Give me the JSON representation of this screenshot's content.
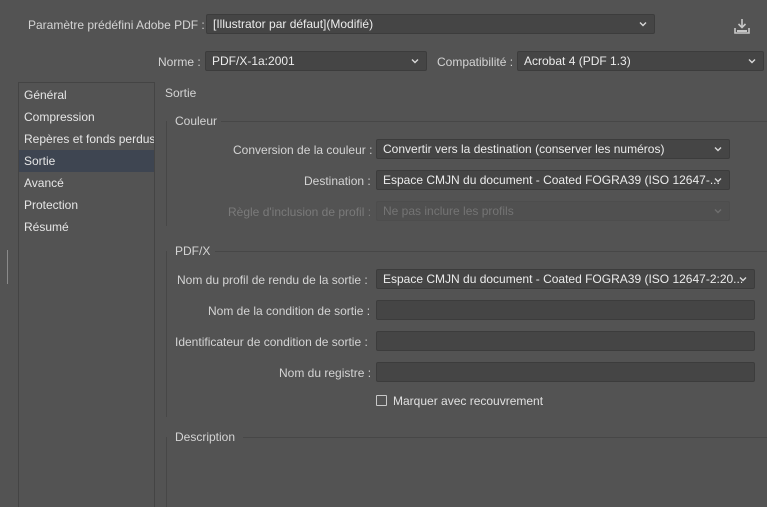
{
  "preset": {
    "label": "Paramètre prédéfini Adobe PDF :",
    "value": "[Illustrator par défaut](Modifié)"
  },
  "standard": {
    "label": "Norme :",
    "value": "PDF/X-1a:2001"
  },
  "compatibility": {
    "label": "Compatibilité :",
    "value": "Acrobat 4 (PDF 1.3)"
  },
  "sidebar": {
    "items": [
      {
        "label": "Général"
      },
      {
        "label": "Compression"
      },
      {
        "label": "Repères et fonds perdus"
      },
      {
        "label": "Sortie"
      },
      {
        "label": "Avancé"
      },
      {
        "label": "Protection"
      },
      {
        "label": "Résumé"
      }
    ],
    "selected": "Sortie"
  },
  "panel": {
    "title": "Sortie",
    "couleur": {
      "title": "Couleur",
      "conversion": {
        "label": "Conversion de la couleur :",
        "value": "Convertir vers la destination (conserver les numéros)"
      },
      "destination": {
        "label": "Destination :",
        "value": "Espace CMJN du document - Coated FOGRA39 (ISO 12647-..."
      },
      "profile_rule": {
        "label": "Règle d'inclusion de profil :",
        "value": "Ne pas inclure les profils"
      }
    },
    "pdfx": {
      "title": "PDF/X",
      "output_profile": {
        "label": "Nom du profil de rendu de la sortie :",
        "value": "Espace CMJN du document - Coated FOGRA39 (ISO 12647-2:20..."
      },
      "condition_name": {
        "label": "Nom de la condition de sortie :",
        "value": ""
      },
      "condition_id": {
        "label": "Identificateur de condition de sortie :",
        "value": ""
      },
      "registry": {
        "label": "Nom du registre :",
        "value": ""
      },
      "trapped": {
        "label": "Marquer avec recouvrement",
        "checked": false
      }
    },
    "description": {
      "title": "Description"
    }
  },
  "icons": {
    "save_preset": "download-icon",
    "chevron": "chevron-down-icon"
  },
  "colors": {
    "background": "#535353",
    "field": "#454545",
    "selected_item": "#3e4551"
  }
}
